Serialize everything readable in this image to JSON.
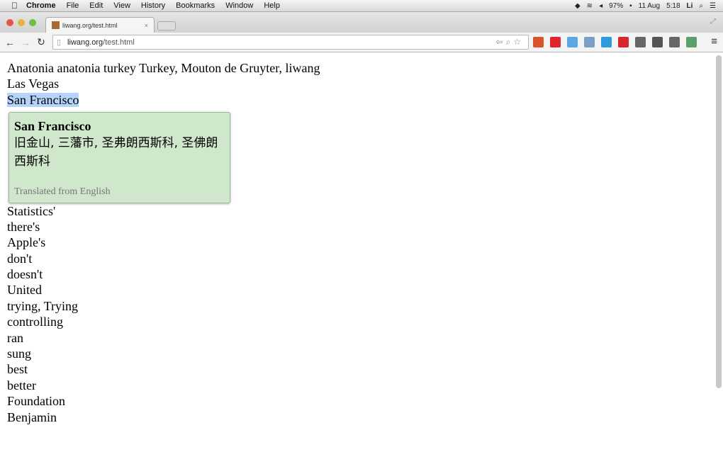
{
  "menubar": {
    "app": "Chrome",
    "items": [
      "File",
      "Edit",
      "View",
      "History",
      "Bookmarks",
      "Window",
      "Help"
    ],
    "status": {
      "battery": "97%",
      "date": "11 Aug",
      "time": "5:18",
      "user": "Li"
    }
  },
  "tab": {
    "title": "liwang.org/test.html"
  },
  "omnibox": {
    "domain": "liwang.org",
    "path": "/test.html"
  },
  "extensions": [
    "#d9532c",
    "#e0262b",
    "#5aa9e6",
    "#7d9fc5",
    "#2e9be0",
    "#d8282f",
    "#666666",
    "#555555",
    "#666666",
    "#5aa06b"
  ],
  "content": {
    "lines": [
      "Anatonia anatonia turkey Turkey, Mouton de Gruyter, liwang",
      "Las Vegas",
      "San Francisco",
      "",
      "",
      "",
      "",
      "",
      "",
      "Statistics'",
      "there's",
      "Apple's",
      "don't",
      "doesn't",
      "United",
      "trying, Trying",
      "controlling",
      "ran",
      "sung",
      "best",
      "better",
      "Foundation",
      "Benjamin"
    ],
    "selected_index": 2
  },
  "popup": {
    "term": "San Francisco",
    "translation": "旧金山, 三藩市, 圣弗朗西斯科, 圣佛朗西斯科",
    "footer": "Translated from English",
    "bg": "#cfe8cb"
  }
}
